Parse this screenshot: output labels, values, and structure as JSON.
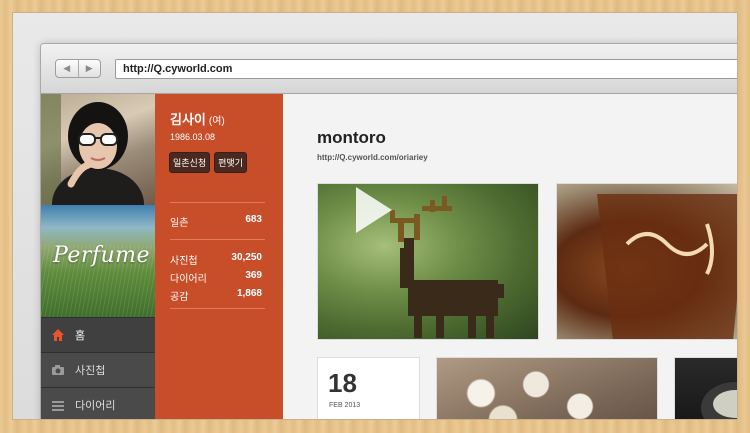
{
  "browser": {
    "url": "http://Q.cyworld.com",
    "nav_back": "◀",
    "nav_forward": "▶"
  },
  "sidebar": {
    "album_title": "Perfume",
    "menu": [
      {
        "label": "홈",
        "icon": "home-icon",
        "active": true
      },
      {
        "label": "사진첩",
        "icon": "camera-icon",
        "active": false
      },
      {
        "label": "다이어리",
        "icon": "list-icon",
        "active": false
      }
    ]
  },
  "profile": {
    "name": "김사이",
    "gender": "(여)",
    "birthdate": "1986.03.08",
    "buttons": [
      "일촌신청",
      "편맺기"
    ],
    "stats": [
      {
        "label": "일촌",
        "value": "683"
      },
      {
        "label": "사진첩",
        "value": "30,250"
      },
      {
        "label": "다이어리",
        "value": "369"
      },
      {
        "label": "공감",
        "value": "1,868"
      }
    ]
  },
  "main": {
    "title": "montoro",
    "url": "http://Q.cyworld.com/oriariey",
    "date_card": {
      "day": "18",
      "month": "FEB 2013"
    }
  },
  "colors": {
    "accent": "#c84e2a",
    "sidebar_bg": "#3d3d3d",
    "active_icon": "#e8542d"
  }
}
